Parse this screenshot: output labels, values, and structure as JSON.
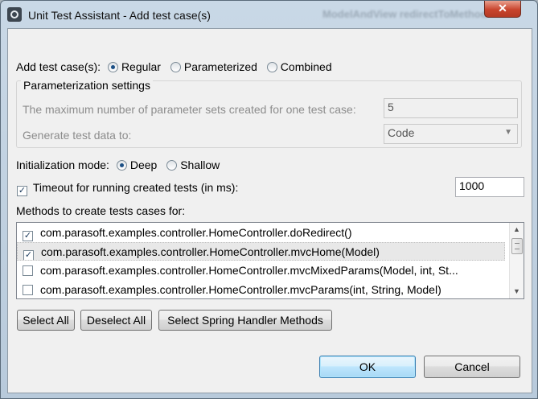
{
  "window": {
    "title": "Unit Test Assistant - Add test case(s)",
    "background_hint": "ModelAndView redirectToMethod",
    "close_label": "✕"
  },
  "add_test_cases": {
    "label": "Add test case(s):",
    "options": [
      "Regular",
      "Parameterized",
      "Combined"
    ],
    "selected": "Regular"
  },
  "parameterization": {
    "title": "Parameterization settings",
    "max_sets_label": "The maximum number of parameter sets created for one test case:",
    "max_sets_value": "5",
    "generate_label": "Generate test data to:",
    "generate_value": "Code"
  },
  "initialization": {
    "label": "Initialization mode:",
    "options": [
      "Deep",
      "Shallow"
    ],
    "selected": "Deep"
  },
  "timeout": {
    "label": "Timeout for running created tests (in ms):",
    "checked": true,
    "value": "1000"
  },
  "methods": {
    "label": "Methods to create tests cases for:",
    "items": [
      {
        "label": "com.parasoft.examples.controller.HomeController.doRedirect()",
        "checked": true
      },
      {
        "label": "com.parasoft.examples.controller.HomeController.mvcHome(Model)",
        "checked": true
      },
      {
        "label": "com.parasoft.examples.controller.HomeController.mvcMixedParams(Model, int, St...",
        "checked": false
      },
      {
        "label": "com.parasoft.examples.controller.HomeController.mvcParams(int, String, Model)",
        "checked": false
      }
    ]
  },
  "buttons": {
    "select_all": "Select All",
    "deselect_all": "Deselect All",
    "select_spring": "Select Spring Handler Methods",
    "ok": "OK",
    "cancel": "Cancel"
  }
}
